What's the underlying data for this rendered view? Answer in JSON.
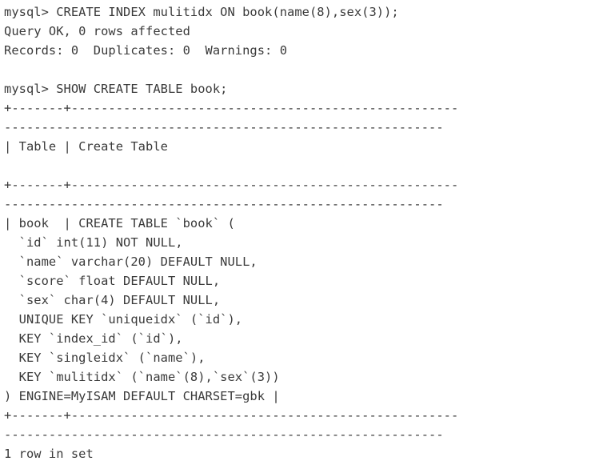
{
  "terminal": {
    "prompt": "mysql>",
    "font_color": "#3a3a3a",
    "background_color": "#ffffff",
    "lines": [
      {
        "name": "create-index-command",
        "text": "mysql> CREATE INDEX mulitidx ON book(name(8),sex(3));"
      },
      {
        "name": "query-ok-status",
        "text": "Query OK, 0 rows affected"
      },
      {
        "name": "records-duplicates-warnings",
        "text": "Records: 0  Duplicates: 0  Warnings: 0"
      },
      {
        "name": "blank-line",
        "text": ""
      },
      {
        "name": "show-create-table-command",
        "text": "mysql> SHOW CREATE TABLE book;"
      },
      {
        "name": "table-separator-top-part1",
        "text": "+-------+----------------------------------------------------"
      },
      {
        "name": "table-separator-top-part2",
        "text": "-----------------------------------------------------------"
      },
      {
        "name": "table-header-row",
        "text": "| Table | Create Table"
      },
      {
        "name": "blank-line",
        "text": ""
      },
      {
        "name": "table-separator-mid-part1",
        "text": "+-------+----------------------------------------------------"
      },
      {
        "name": "table-separator-mid-part2",
        "text": "-----------------------------------------------------------"
      },
      {
        "name": "create-table-row-open",
        "text": "| book  | CREATE TABLE `book` ("
      },
      {
        "name": "column-definition-id",
        "text": "  `id` int(11) NOT NULL,"
      },
      {
        "name": "column-definition-name",
        "text": "  `name` varchar(20) DEFAULT NULL,"
      },
      {
        "name": "column-definition-score",
        "text": "  `score` float DEFAULT NULL,"
      },
      {
        "name": "column-definition-sex",
        "text": "  `sex` char(4) DEFAULT NULL,"
      },
      {
        "name": "key-definition-uniqueidx",
        "text": "  UNIQUE KEY `uniqueidx` (`id`),"
      },
      {
        "name": "key-definition-index-id",
        "text": "  KEY `index_id` (`id`),"
      },
      {
        "name": "key-definition-singleidx",
        "text": "  KEY `singleidx` (`name`),"
      },
      {
        "name": "key-definition-mulitidx",
        "text": "  KEY `mulitidx` (`name`(8),`sex`(3))"
      },
      {
        "name": "table-options-row",
        "text": ") ENGINE=MyISAM DEFAULT CHARSET=gbk |"
      },
      {
        "name": "table-separator-bot-part1",
        "text": "+-------+----------------------------------------------------"
      },
      {
        "name": "table-separator-bot-part2",
        "text": "-----------------------------------------------------------"
      },
      {
        "name": "row-count-status",
        "text": "1 row in set"
      }
    ]
  }
}
